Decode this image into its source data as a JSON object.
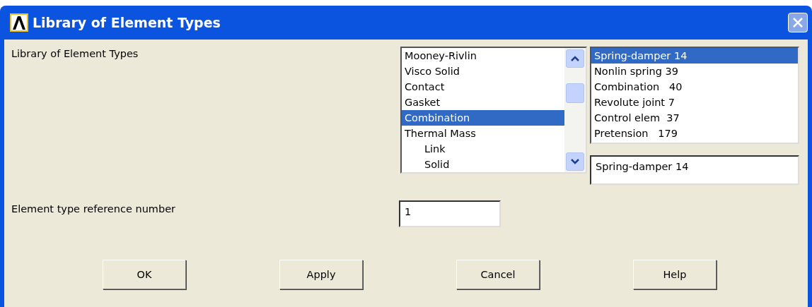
{
  "window": {
    "title": "Library of Element Types"
  },
  "library_label": "Library of Element Types",
  "category_list": [
    {
      "label": "Mooney-Rivlin",
      "selected": false
    },
    {
      "label": "Visco Solid",
      "selected": false
    },
    {
      "label": "Contact",
      "selected": false
    },
    {
      "label": "Gasket",
      "selected": false
    },
    {
      "label": "Combination",
      "selected": true
    },
    {
      "label": "Thermal Mass",
      "selected": false,
      "children": [
        {
          "label": "Link",
          "selected": false
        },
        {
          "label": "Solid",
          "selected": false
        }
      ]
    }
  ],
  "element_list": [
    {
      "label": "Spring-damper 14",
      "selected": true
    },
    {
      "label": "Nonlin spring 39",
      "selected": false
    },
    {
      "label": "Combination   40",
      "selected": false
    },
    {
      "label": "Revolute joint 7",
      "selected": false
    },
    {
      "label": "Control elem  37",
      "selected": false
    },
    {
      "label": "Pretension   179",
      "selected": false
    }
  ],
  "selection_field": {
    "value": "Spring-damper 14"
  },
  "reference": {
    "label": "Element type reference number",
    "value": "1"
  },
  "buttons": [
    "OK",
    "Apply",
    "Cancel",
    "Help"
  ]
}
